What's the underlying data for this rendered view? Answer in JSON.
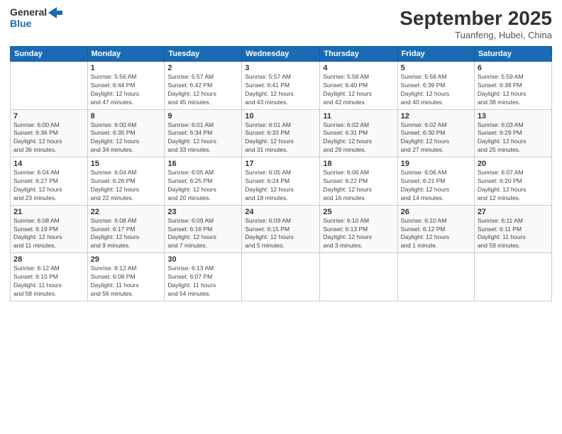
{
  "logo": {
    "line1": "General",
    "line2": "Blue"
  },
  "header": {
    "month": "September 2025",
    "location": "Tuanfeng, Hubei, China"
  },
  "days": [
    "Sunday",
    "Monday",
    "Tuesday",
    "Wednesday",
    "Thursday",
    "Friday",
    "Saturday"
  ],
  "weeks": [
    [
      {
        "num": "",
        "info": ""
      },
      {
        "num": "1",
        "info": "Sunrise: 5:56 AM\nSunset: 6:44 PM\nDaylight: 12 hours\nand 47 minutes."
      },
      {
        "num": "2",
        "info": "Sunrise: 5:57 AM\nSunset: 6:42 PM\nDaylight: 12 hours\nand 45 minutes."
      },
      {
        "num": "3",
        "info": "Sunrise: 5:57 AM\nSunset: 6:41 PM\nDaylight: 12 hours\nand 43 minutes."
      },
      {
        "num": "4",
        "info": "Sunrise: 5:58 AM\nSunset: 6:40 PM\nDaylight: 12 hours\nand 42 minutes."
      },
      {
        "num": "5",
        "info": "Sunrise: 5:58 AM\nSunset: 6:39 PM\nDaylight: 12 hours\nand 40 minutes."
      },
      {
        "num": "6",
        "info": "Sunrise: 5:59 AM\nSunset: 6:38 PM\nDaylight: 12 hours\nand 38 minutes."
      }
    ],
    [
      {
        "num": "7",
        "info": "Sunrise: 6:00 AM\nSunset: 6:36 PM\nDaylight: 12 hours\nand 36 minutes."
      },
      {
        "num": "8",
        "info": "Sunrise: 6:00 AM\nSunset: 6:35 PM\nDaylight: 12 hours\nand 34 minutes."
      },
      {
        "num": "9",
        "info": "Sunrise: 6:01 AM\nSunset: 6:34 PM\nDaylight: 12 hours\nand 33 minutes."
      },
      {
        "num": "10",
        "info": "Sunrise: 6:01 AM\nSunset: 6:33 PM\nDaylight: 12 hours\nand 31 minutes."
      },
      {
        "num": "11",
        "info": "Sunrise: 6:02 AM\nSunset: 6:31 PM\nDaylight: 12 hours\nand 29 minutes."
      },
      {
        "num": "12",
        "info": "Sunrise: 6:02 AM\nSunset: 6:30 PM\nDaylight: 12 hours\nand 27 minutes."
      },
      {
        "num": "13",
        "info": "Sunrise: 6:03 AM\nSunset: 6:29 PM\nDaylight: 12 hours\nand 25 minutes."
      }
    ],
    [
      {
        "num": "14",
        "info": "Sunrise: 6:04 AM\nSunset: 6:27 PM\nDaylight: 12 hours\nand 23 minutes."
      },
      {
        "num": "15",
        "info": "Sunrise: 6:04 AM\nSunset: 6:26 PM\nDaylight: 12 hours\nand 22 minutes."
      },
      {
        "num": "16",
        "info": "Sunrise: 6:05 AM\nSunset: 6:25 PM\nDaylight: 12 hours\nand 20 minutes."
      },
      {
        "num": "17",
        "info": "Sunrise: 6:05 AM\nSunset: 6:24 PM\nDaylight: 12 hours\nand 18 minutes."
      },
      {
        "num": "18",
        "info": "Sunrise: 6:06 AM\nSunset: 6:22 PM\nDaylight: 12 hours\nand 16 minutes."
      },
      {
        "num": "19",
        "info": "Sunrise: 6:06 AM\nSunset: 6:21 PM\nDaylight: 12 hours\nand 14 minutes."
      },
      {
        "num": "20",
        "info": "Sunrise: 6:07 AM\nSunset: 6:20 PM\nDaylight: 12 hours\nand 12 minutes."
      }
    ],
    [
      {
        "num": "21",
        "info": "Sunrise: 6:08 AM\nSunset: 6:19 PM\nDaylight: 12 hours\nand 11 minutes."
      },
      {
        "num": "22",
        "info": "Sunrise: 6:08 AM\nSunset: 6:17 PM\nDaylight: 12 hours\nand 9 minutes."
      },
      {
        "num": "23",
        "info": "Sunrise: 6:09 AM\nSunset: 6:16 PM\nDaylight: 12 hours\nand 7 minutes."
      },
      {
        "num": "24",
        "info": "Sunrise: 6:09 AM\nSunset: 6:15 PM\nDaylight: 12 hours\nand 5 minutes."
      },
      {
        "num": "25",
        "info": "Sunrise: 6:10 AM\nSunset: 6:13 PM\nDaylight: 12 hours\nand 3 minutes."
      },
      {
        "num": "26",
        "info": "Sunrise: 6:10 AM\nSunset: 6:12 PM\nDaylight: 12 hours\nand 1 minute."
      },
      {
        "num": "27",
        "info": "Sunrise: 6:11 AM\nSunset: 6:11 PM\nDaylight: 11 hours\nand 59 minutes."
      }
    ],
    [
      {
        "num": "28",
        "info": "Sunrise: 6:12 AM\nSunset: 6:10 PM\nDaylight: 11 hours\nand 58 minutes."
      },
      {
        "num": "29",
        "info": "Sunrise: 6:12 AM\nSunset: 6:08 PM\nDaylight: 11 hours\nand 56 minutes."
      },
      {
        "num": "30",
        "info": "Sunrise: 6:13 AM\nSunset: 6:07 PM\nDaylight: 11 hours\nand 54 minutes."
      },
      {
        "num": "",
        "info": ""
      },
      {
        "num": "",
        "info": ""
      },
      {
        "num": "",
        "info": ""
      },
      {
        "num": "",
        "info": ""
      }
    ]
  ]
}
